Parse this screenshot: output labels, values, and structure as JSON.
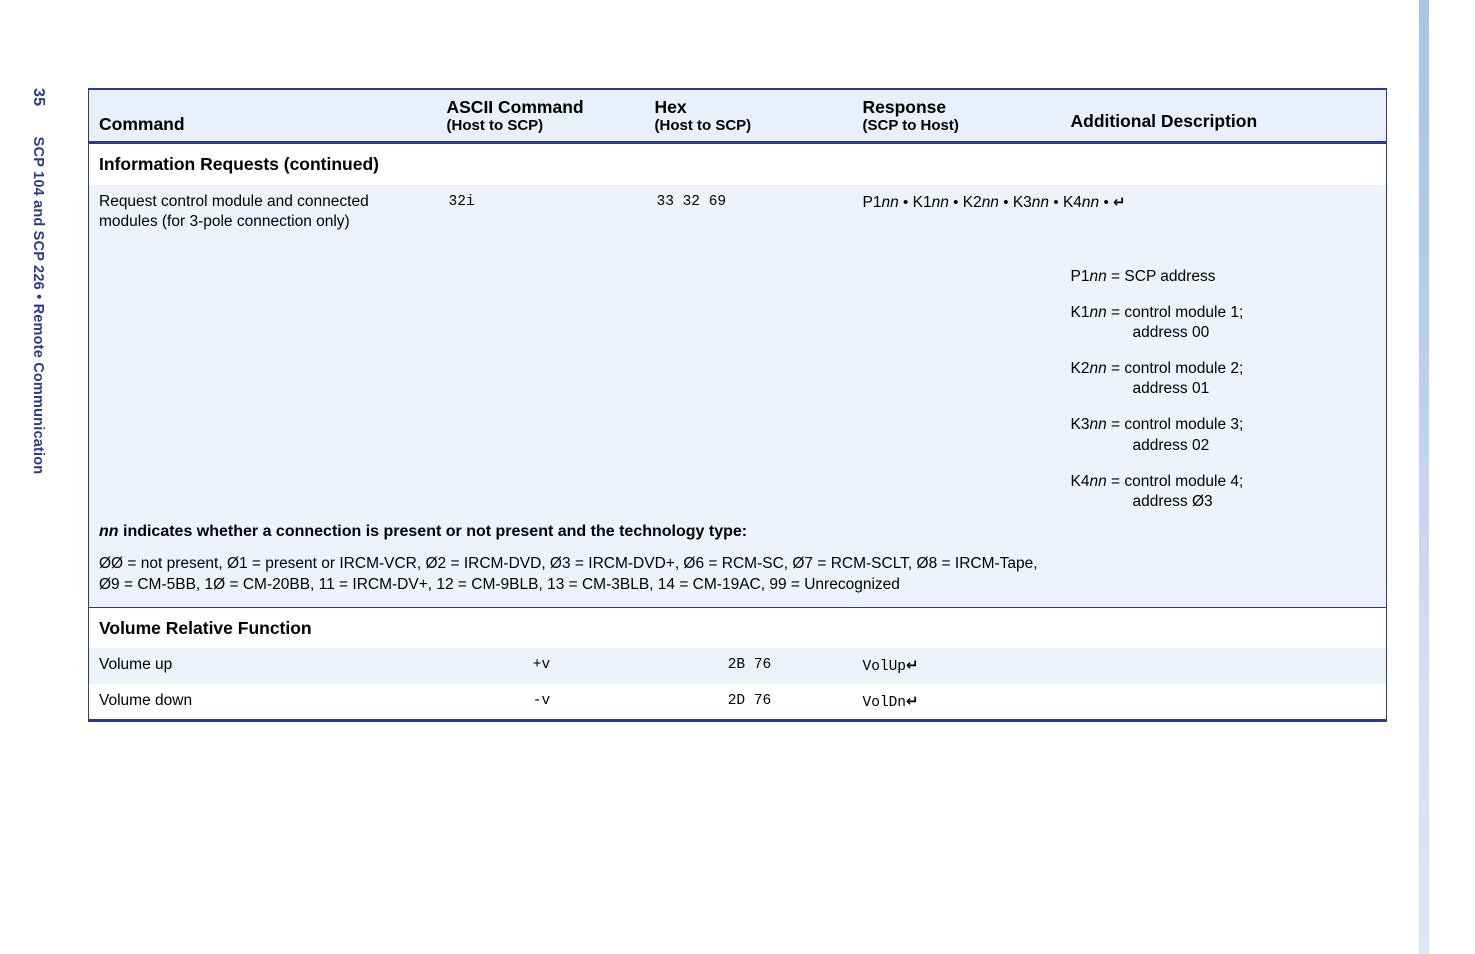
{
  "sidebar": {
    "page_number": "35",
    "running_head": "SCP 104 and SCP 226 • Remote Communication",
    "color": "#2a3b8f"
  },
  "table": {
    "headers": {
      "command": "Command",
      "ascii_main": "ASCII Command",
      "ascii_sub": "(Host to SCP)",
      "hex_main": "Hex",
      "hex_sub": "(Host to SCP)",
      "response_main": "Response",
      "response_sub": "(SCP to Host)",
      "additional": "Additional Description"
    },
    "sections": [
      {
        "title": "Information Requests (continued)",
        "rows": [
          {
            "command": "Request control module and connected modules (for 3-pole connection only)",
            "ascii": "32i",
            "hex": "33 32 69",
            "response_parts": {
              "p1": "P1",
              "k1": "K1",
              "k2": "K2",
              "k3": "K3",
              "k4": "K4",
              "nn": "nn",
              "bullet": "•",
              "return_glyph": "↵"
            },
            "descriptions": [
              {
                "code": "P1",
                "var": "nn",
                "equals": "=",
                "text": "SCP address",
                "cont": ""
              },
              {
                "code": "K1",
                "var": "nn",
                "equals": "=",
                "text": "control module 1;",
                "cont": "address 00"
              },
              {
                "code": "K2",
                "var": "nn",
                "equals": "=",
                "text": "control module 2;",
                "cont": "address 01"
              },
              {
                "code": "K3",
                "var": "nn",
                "equals": "=",
                "text": "control module 3;",
                "cont": "address 02"
              },
              {
                "code": "K4",
                "var": "nn",
                "equals": "=",
                "text": "control module 4;",
                "cont": "address Ø3"
              }
            ]
          }
        ],
        "notes": {
          "lead_var": "nn",
          "lead_text": " indicates whether a connection is present or not present and the technology type:",
          "codes_line_1": "ØØ = not present, Ø1 = present or IRCM-VCR, Ø2 = IRCM-DVD, Ø3 = IRCM-DVD+, Ø6 = RCM-SC, Ø7 = RCM-SCLT, Ø8 = IRCM-Tape,",
          "codes_line_2": "Ø9 = CM-5BB, 1Ø = CM-20BB, 11 = IRCM-DV+, 12 = CM-9BLB, 13 = CM-3BLB, 14 = CM-19AC, 99 = Unrecognized"
        }
      },
      {
        "title": "Volume Relative Function",
        "rows": [
          {
            "command": "Volume up",
            "ascii": "+v",
            "hex": "2B 76",
            "response": "VolUp",
            "return_glyph": "↵"
          },
          {
            "command": "Volume down",
            "ascii": "-v",
            "hex": "2D 76",
            "response": "VolDn",
            "return_glyph": "↵"
          }
        ]
      }
    ]
  },
  "colors": {
    "rule": "#2a3b8f",
    "header_fill": "#e9f0fb",
    "row_shade": "#edf2fb",
    "edge_bar_top": "#a9c2e8",
    "edge_bar_bottom": "#dde6f6"
  }
}
